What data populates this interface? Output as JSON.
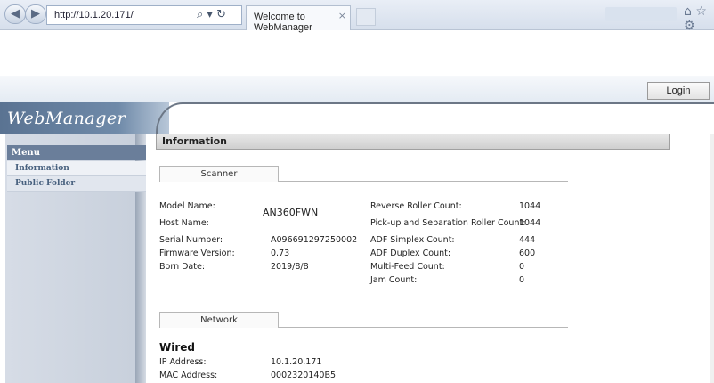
{
  "browser": {
    "address": "http://10.1.20.171/",
    "address_icons": "⌕ ▾ ↻",
    "tab_title": "Welcome to WebManager",
    "tab_close": "×",
    "back_icon": "◀",
    "forward_icon": "▶",
    "right_icons": "⌂ ☆ ⚙"
  },
  "header": {
    "login_label": "Login",
    "logo": "WebManager"
  },
  "sidebar": {
    "menu_heading": "Menu",
    "items": [
      {
        "label": "Information"
      },
      {
        "label": "Public Folder"
      }
    ]
  },
  "main": {
    "title": "Information",
    "scanner_tab": "Scanner",
    "network_tab": "Network",
    "scanner_left": [
      {
        "label": "Model Name:",
        "value": "AN360FWN"
      },
      {
        "label": "Host Name:",
        "value": ""
      },
      {
        "label": "Serial Number:",
        "value": "A096691297250002"
      },
      {
        "label": "Firmware Version:",
        "value": "0.73"
      },
      {
        "label": "Born Date:",
        "value": "2019/8/8"
      }
    ],
    "scanner_right": [
      {
        "label": "Reverse Roller Count:",
        "value": "1044"
      },
      {
        "label": "Pick-up and Separation Roller Count:",
        "value": "1044"
      },
      {
        "label": "ADF Simplex Count:",
        "value": "444"
      },
      {
        "label": "ADF Duplex Count:",
        "value": "600"
      },
      {
        "label": "Multi-Feed Count:",
        "value": "0"
      },
      {
        "label": "Jam Count:",
        "value": "0"
      }
    ],
    "wired_heading": "Wired",
    "network": [
      {
        "label": "IP Address:",
        "value": "10.1.20.171"
      },
      {
        "label": "MAC Address:",
        "value": "0002320140B5"
      }
    ]
  }
}
